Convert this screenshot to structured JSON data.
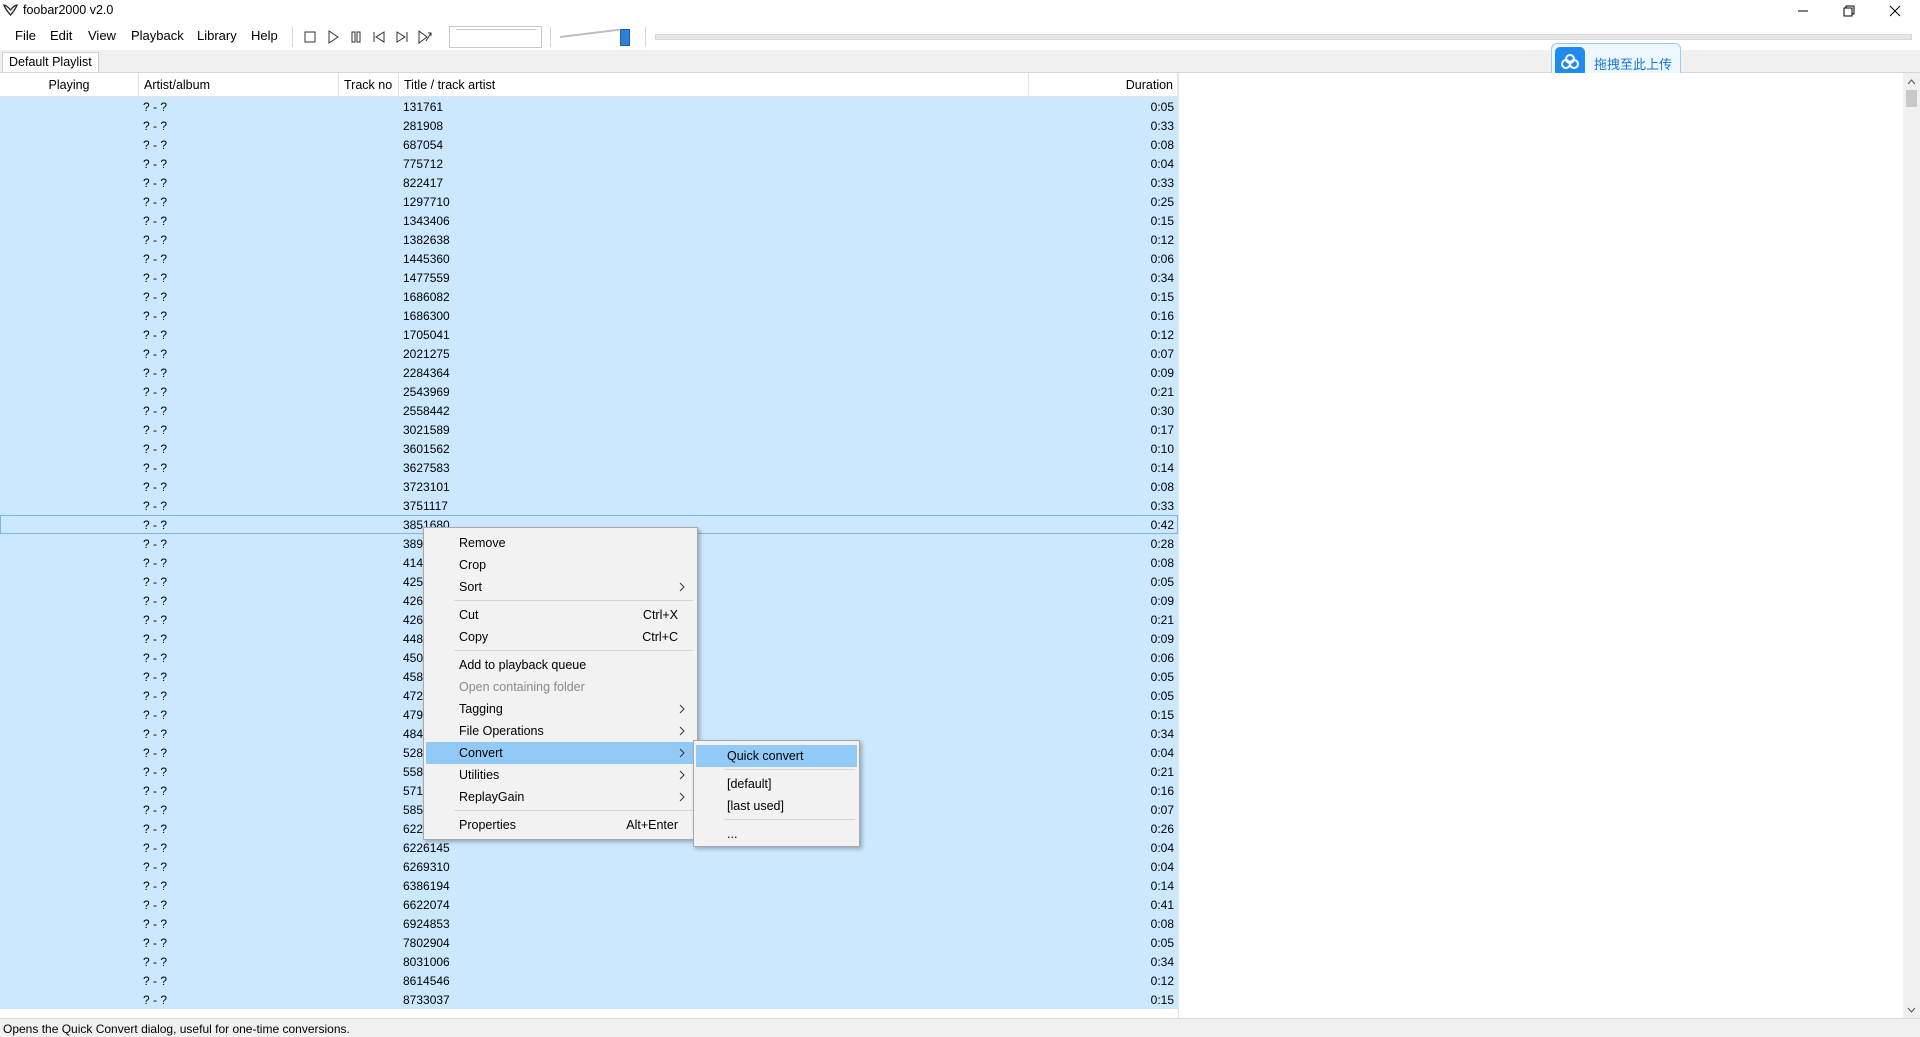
{
  "window": {
    "title": "foobar2000 v2.0"
  },
  "menubar": {
    "items": [
      "File",
      "Edit",
      "View",
      "Playback",
      "Library",
      "Help"
    ]
  },
  "tabs": {
    "playlist": "Default Playlist"
  },
  "upload": {
    "label": "拖拽至此上传"
  },
  "columns": {
    "playing": "Playing",
    "artist": "Artist/album",
    "trackno": "Track no",
    "title": "Title / track artist",
    "duration": "Duration"
  },
  "rows": [
    {
      "artist": "? - ?",
      "title": "131761",
      "duration": "0:05"
    },
    {
      "artist": "? - ?",
      "title": "281908",
      "duration": "0:33"
    },
    {
      "artist": "? - ?",
      "title": "687054",
      "duration": "0:08"
    },
    {
      "artist": "? - ?",
      "title": "775712",
      "duration": "0:04"
    },
    {
      "artist": "? - ?",
      "title": "822417",
      "duration": "0:33"
    },
    {
      "artist": "? - ?",
      "title": "1297710",
      "duration": "0:25"
    },
    {
      "artist": "? - ?",
      "title": "1343406",
      "duration": "0:15"
    },
    {
      "artist": "? - ?",
      "title": "1382638",
      "duration": "0:12"
    },
    {
      "artist": "? - ?",
      "title": "1445360",
      "duration": "0:06"
    },
    {
      "artist": "? - ?",
      "title": "1477559",
      "duration": "0:34"
    },
    {
      "artist": "? - ?",
      "title": "1686082",
      "duration": "0:15"
    },
    {
      "artist": "? - ?",
      "title": "1686300",
      "duration": "0:16"
    },
    {
      "artist": "? - ?",
      "title": "1705041",
      "duration": "0:12"
    },
    {
      "artist": "? - ?",
      "title": "2021275",
      "duration": "0:07"
    },
    {
      "artist": "? - ?",
      "title": "2284364",
      "duration": "0:09"
    },
    {
      "artist": "? - ?",
      "title": "2543969",
      "duration": "0:21"
    },
    {
      "artist": "? - ?",
      "title": "2558442",
      "duration": "0:30"
    },
    {
      "artist": "? - ?",
      "title": "3021589",
      "duration": "0:17"
    },
    {
      "artist": "? - ?",
      "title": "3601562",
      "duration": "0:10"
    },
    {
      "artist": "? - ?",
      "title": "3627583",
      "duration": "0:14"
    },
    {
      "artist": "? - ?",
      "title": "3723101",
      "duration": "0:08"
    },
    {
      "artist": "? - ?",
      "title": "3751117",
      "duration": "0:33"
    },
    {
      "artist": "? - ?",
      "title": "3851680",
      "duration": "0:42",
      "focus": true
    },
    {
      "artist": "? - ?",
      "title": "389",
      "duration": "0:28"
    },
    {
      "artist": "? - ?",
      "title": "414",
      "duration": "0:08"
    },
    {
      "artist": "? - ?",
      "title": "425",
      "duration": "0:05"
    },
    {
      "artist": "? - ?",
      "title": "426",
      "duration": "0:09"
    },
    {
      "artist": "? - ?",
      "title": "426",
      "duration": "0:21"
    },
    {
      "artist": "? - ?",
      "title": "448",
      "duration": "0:09"
    },
    {
      "artist": "? - ?",
      "title": "450",
      "duration": "0:06"
    },
    {
      "artist": "? - ?",
      "title": "458",
      "duration": "0:05"
    },
    {
      "artist": "? - ?",
      "title": "472",
      "duration": "0:05"
    },
    {
      "artist": "? - ?",
      "title": "479",
      "duration": "0:15"
    },
    {
      "artist": "? - ?",
      "title": "484",
      "duration": "0:34"
    },
    {
      "artist": "? - ?",
      "title": "528",
      "duration": "0:04"
    },
    {
      "artist": "? - ?",
      "title": "558",
      "duration": "0:21"
    },
    {
      "artist": "? - ?",
      "title": "571",
      "duration": "0:16"
    },
    {
      "artist": "? - ?",
      "title": "585",
      "duration": "0:07"
    },
    {
      "artist": "? - ?",
      "title": "622",
      "duration": "0:26"
    },
    {
      "artist": "? - ?",
      "title": "6226145",
      "duration": "0:04"
    },
    {
      "artist": "? - ?",
      "title": "6269310",
      "duration": "0:04"
    },
    {
      "artist": "? - ?",
      "title": "6386194",
      "duration": "0:14"
    },
    {
      "artist": "? - ?",
      "title": "6622074",
      "duration": "0:41"
    },
    {
      "artist": "? - ?",
      "title": "6924853",
      "duration": "0:08"
    },
    {
      "artist": "? - ?",
      "title": "7802904",
      "duration": "0:05"
    },
    {
      "artist": "? - ?",
      "title": "8031006",
      "duration": "0:34"
    },
    {
      "artist": "? - ?",
      "title": "8614546",
      "duration": "0:12"
    },
    {
      "artist": "? - ?",
      "title": "8733037",
      "duration": "0:15"
    }
  ],
  "context_menu": {
    "items": [
      {
        "label": "Remove"
      },
      {
        "label": "Crop"
      },
      {
        "label": "Sort",
        "submenu": true
      },
      {
        "separator": true
      },
      {
        "label": "Cut",
        "shortcut": "Ctrl+X"
      },
      {
        "label": "Copy",
        "shortcut": "Ctrl+C"
      },
      {
        "separator": true
      },
      {
        "label": "Add to playback queue"
      },
      {
        "label": "Open containing folder",
        "disabled": true
      },
      {
        "label": "Tagging",
        "submenu": true
      },
      {
        "label": "File Operations",
        "submenu": true
      },
      {
        "label": "Convert",
        "submenu": true,
        "highlighted": true
      },
      {
        "label": "Utilities",
        "submenu": true
      },
      {
        "label": "ReplayGain",
        "submenu": true
      },
      {
        "separator": true
      },
      {
        "label": "Properties",
        "shortcut": "Alt+Enter"
      }
    ]
  },
  "convert_submenu": {
    "items": [
      {
        "label": "Quick convert",
        "highlighted": true
      },
      {
        "separator": true
      },
      {
        "label": "[default]"
      },
      {
        "label": "[last used]"
      },
      {
        "separator": true
      },
      {
        "label": "..."
      }
    ]
  },
  "status": {
    "text": "Opens the Quick Convert dialog, useful for one-time conversions."
  },
  "colors": {
    "selection": "#cce8ff",
    "menu_highlight": "#91c9f7",
    "accent": "#2f7fd4"
  }
}
